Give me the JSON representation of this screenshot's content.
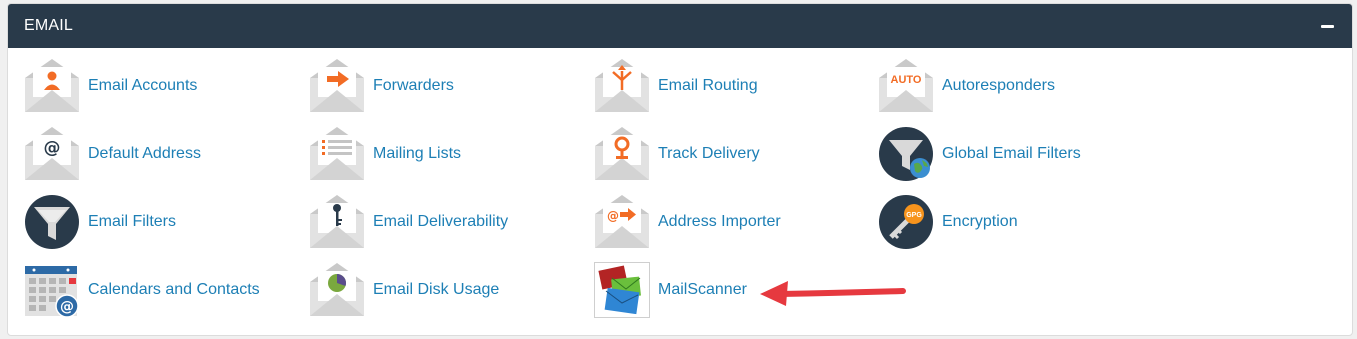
{
  "section": {
    "title": "EMAIL",
    "collapse_icon": "minus-icon"
  },
  "colors": {
    "header_bg": "#293a4a",
    "link": "#1d7fb5",
    "accent_orange": "#f26c25",
    "arrow_red": "#e6393f"
  },
  "items": [
    {
      "label": "Email Accounts",
      "icon": "email-accounts-icon"
    },
    {
      "label": "Forwarders",
      "icon": "forwarders-icon"
    },
    {
      "label": "Email Routing",
      "icon": "email-routing-icon"
    },
    {
      "label": "Autoresponders",
      "icon": "autoresponders-icon",
      "icon_text": "AUTO"
    },
    {
      "label": "Default Address",
      "icon": "default-address-icon"
    },
    {
      "label": "Mailing Lists",
      "icon": "mailing-lists-icon"
    },
    {
      "label": "Track Delivery",
      "icon": "track-delivery-icon"
    },
    {
      "label": "Global Email Filters",
      "icon": "global-email-filters-icon"
    },
    {
      "label": "Email Filters",
      "icon": "email-filters-icon"
    },
    {
      "label": "Email Deliverability",
      "icon": "email-deliverability-icon"
    },
    {
      "label": "Address Importer",
      "icon": "address-importer-icon"
    },
    {
      "label": "Encryption",
      "icon": "encryption-icon",
      "icon_text": "GPG"
    },
    {
      "label": "Calendars and Contacts",
      "icon": "calendars-contacts-icon"
    },
    {
      "label": "Email Disk Usage",
      "icon": "email-disk-usage-icon"
    },
    {
      "label": "MailScanner",
      "icon": "mailscanner-icon"
    }
  ],
  "annotation": {
    "icon": "red-arrow-pointer-icon"
  }
}
